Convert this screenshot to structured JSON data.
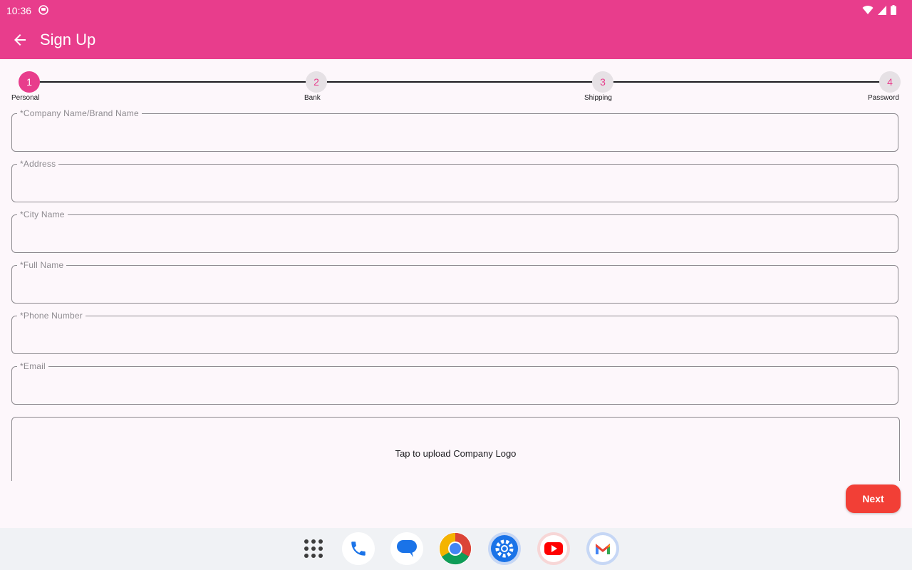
{
  "status_bar": {
    "time": "10:36"
  },
  "toolbar": {
    "title": "Sign Up"
  },
  "stepper": {
    "steps": [
      {
        "number": "1",
        "label": "Personal",
        "active": true
      },
      {
        "number": "2",
        "label": "Bank",
        "active": false
      },
      {
        "number": "3",
        "label": "Shipping",
        "active": false
      },
      {
        "number": "4",
        "label": "Password",
        "active": false
      }
    ]
  },
  "form": {
    "fields": [
      {
        "label": "*Company Name/Brand Name",
        "value": ""
      },
      {
        "label": "*Address",
        "value": ""
      },
      {
        "label": "*City Name",
        "value": ""
      },
      {
        "label": "*Full Name",
        "value": ""
      },
      {
        "label": "*Phone Number",
        "value": ""
      },
      {
        "label": "*Email",
        "value": ""
      }
    ],
    "upload_text": "Tap to upload Company Logo",
    "next_label": "Next"
  },
  "dock": {
    "apps": [
      "app-drawer-icon",
      "phone-icon",
      "messages-icon",
      "chrome-icon",
      "settings-icon",
      "youtube-icon",
      "gmail-icon"
    ]
  },
  "colors": {
    "primary": "#e83d8c",
    "next_button": "#f23f36",
    "background": "#fdf7fb"
  }
}
